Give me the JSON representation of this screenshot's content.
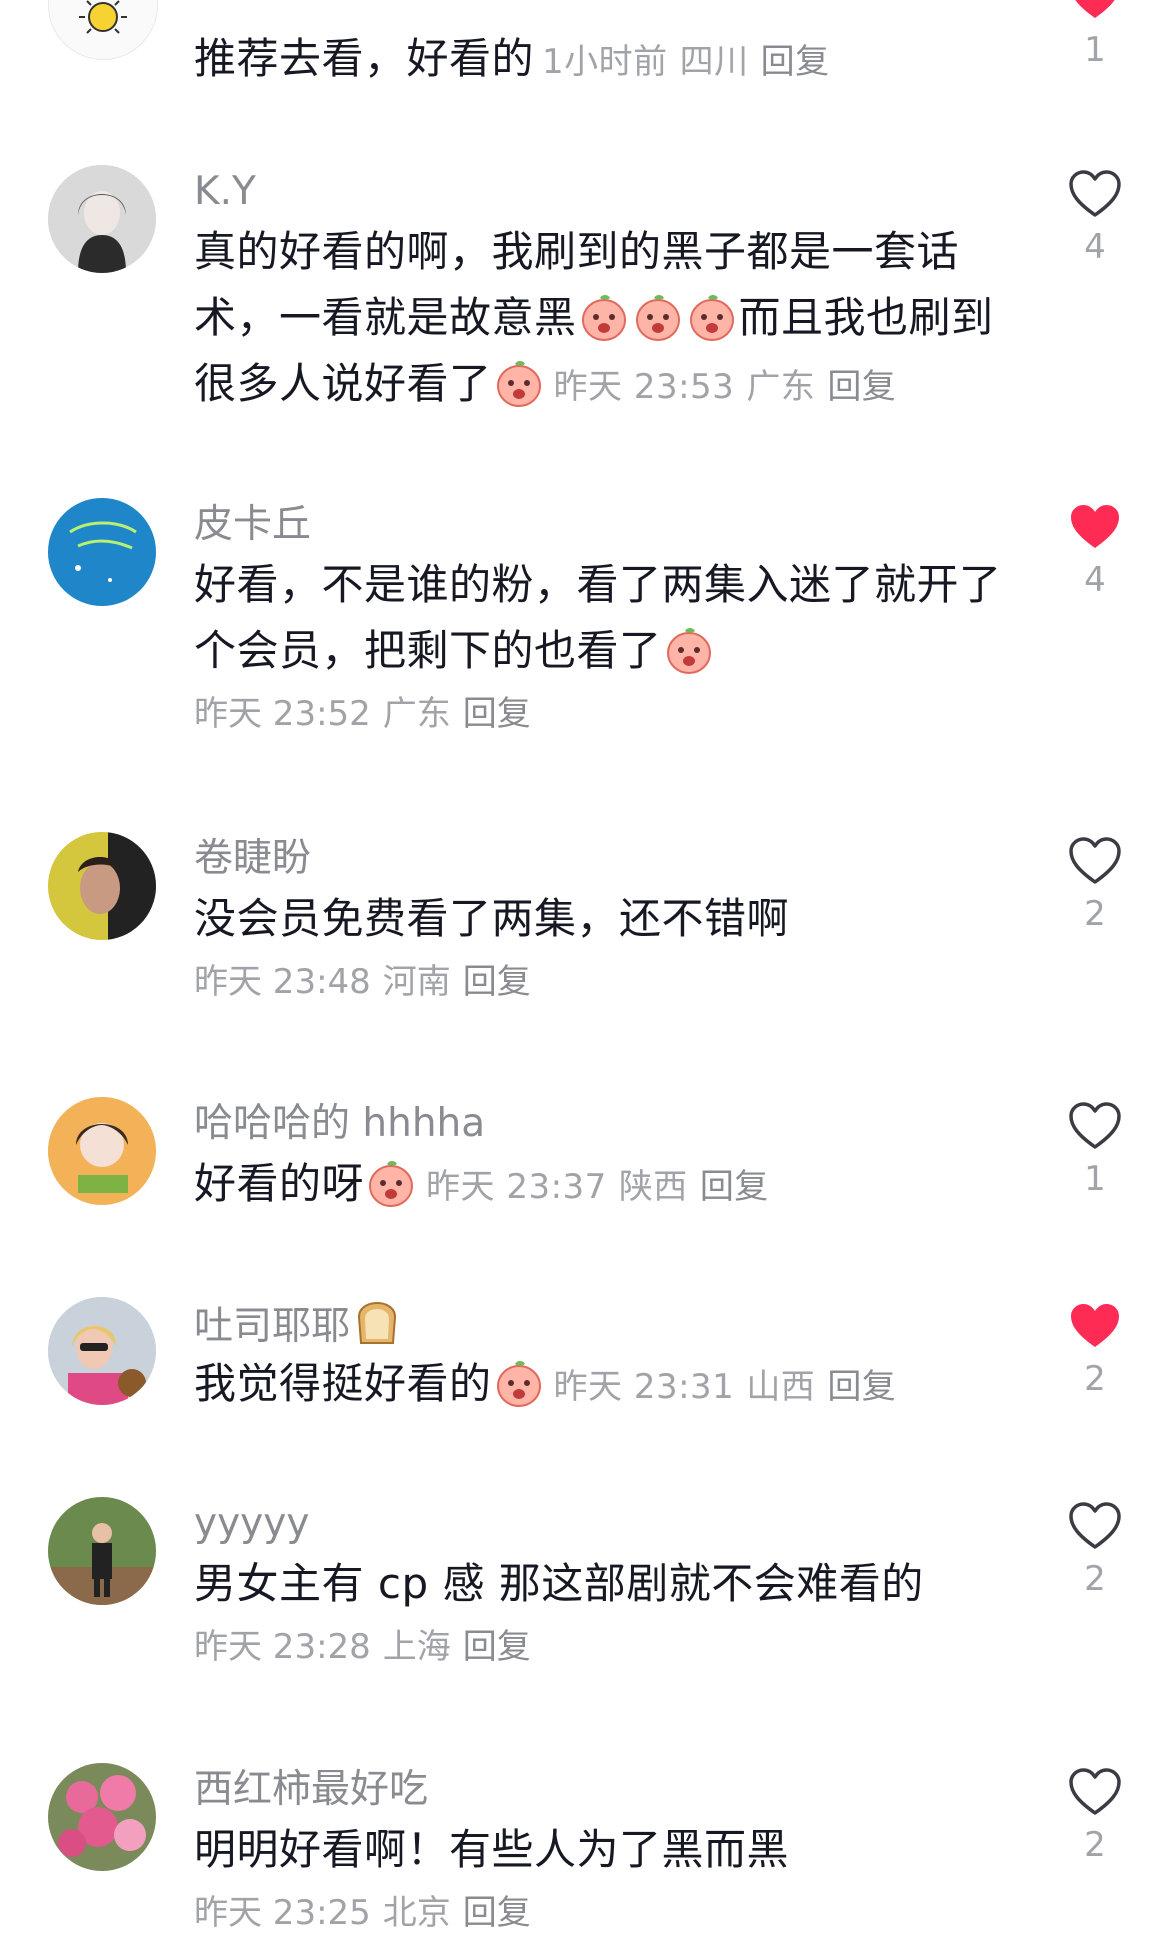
{
  "comments": [
    {
      "id": "c0",
      "username": "",
      "text": "推荐去看，好看的",
      "time": "1小时前",
      "location": "四川",
      "reply_label": "回复",
      "likes": "1",
      "liked": true
    },
    {
      "id": "c1",
      "username": "K.Y",
      "text_parts": [
        "真的好看的啊，我刷到的黑子都是一套话术，一看就是故意黑",
        "而且我也刷到很多人说好看了"
      ],
      "time": "昨天 23:53",
      "location": "广东",
      "reply_label": "回复",
      "likes": "4",
      "liked": false
    },
    {
      "id": "c2",
      "username": "皮卡丘",
      "text": "好看，不是谁的粉，看了两集入迷了就开了个会员，把剩下的也看了",
      "time": "昨天 23:52",
      "location": "广东",
      "reply_label": "回复",
      "likes": "4",
      "liked": true
    },
    {
      "id": "c3",
      "username": "卷睫盼",
      "text": "没会员免费看了两集，还不错啊",
      "time": "昨天 23:48",
      "location": "河南",
      "reply_label": "回复",
      "likes": "2",
      "liked": false
    },
    {
      "id": "c4",
      "username": "哈哈哈的 hhhha",
      "text": "好看的呀",
      "time": "昨天 23:37",
      "location": "陕西",
      "reply_label": "回复",
      "likes": "1",
      "liked": false
    },
    {
      "id": "c5",
      "username": "吐司耶耶",
      "text": "我觉得挺好看的",
      "time": "昨天 23:31",
      "location": "山西",
      "reply_label": "回复",
      "likes": "2",
      "liked": true
    },
    {
      "id": "c6",
      "username": "yyyyy",
      "text": "男女主有 cp 感 那这部剧就不会难看的",
      "time": "昨天 23:28",
      "location": "上海",
      "reply_label": "回复",
      "likes": "2",
      "liked": false
    },
    {
      "id": "c7",
      "username": "西红柿最好吃",
      "text": "明明好看啊！有些人为了黑而黑",
      "time": "昨天 23:25",
      "location": "北京",
      "reply_label": "回复",
      "likes": "2",
      "liked": false
    }
  ],
  "icons": {
    "heart_outline": "heart-outline-icon",
    "heart_filled": "heart-filled-icon",
    "emoji": "peach-emoji-icon",
    "bread": "bread-emoji-icon"
  },
  "colors": {
    "liked": "#fe2c55",
    "meta": "#a2a3a8",
    "username": "#8a8b91",
    "text": "#161823"
  }
}
